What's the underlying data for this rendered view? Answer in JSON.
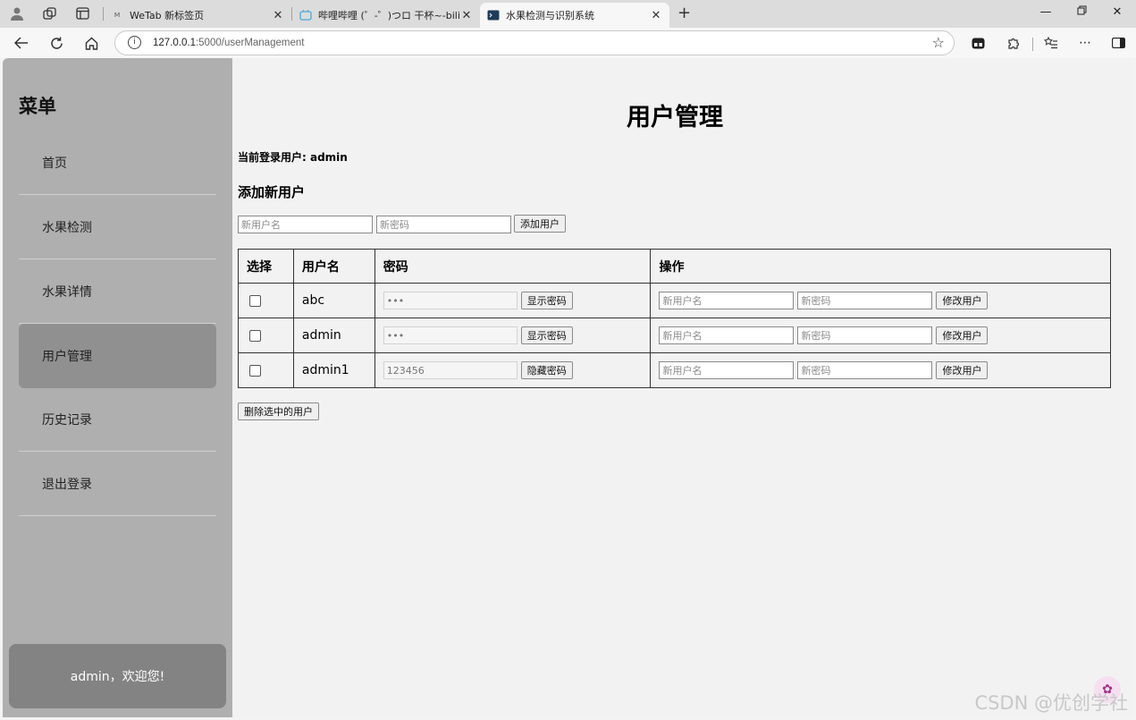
{
  "browser": {
    "tabs": [
      {
        "title": "WeTab 新标签页",
        "active": false
      },
      {
        "title": "哔哩哔哩 (゜-゜)つロ 干杯~-bilibili",
        "active": false
      },
      {
        "title": "水果检测与识别系统",
        "active": true
      }
    ],
    "url_host": "127.0.0.1",
    "url_path": ":5000/userManagement"
  },
  "sidebar": {
    "title": "菜单",
    "items": [
      {
        "label": "首页"
      },
      {
        "label": "水果检测"
      },
      {
        "label": "水果详情"
      },
      {
        "label": "用户管理"
      },
      {
        "label": "历史记录"
      },
      {
        "label": "退出登录"
      }
    ],
    "welcome": "admin，欢迎您!"
  },
  "main": {
    "title": "用户管理",
    "current_user": "当前登录用户: admin",
    "add_heading": "添加新用户",
    "add_form": {
      "username_placeholder": "新用户名",
      "password_placeholder": "新密码",
      "add_button": "添加用户"
    },
    "table": {
      "headers": [
        "选择",
        "用户名",
        "密码",
        "操作"
      ],
      "rows": [
        {
          "username": "abc",
          "password_display": "•••",
          "toggle_label": "显示密码",
          "new_username_placeholder": "新用户名",
          "new_password_placeholder": "新密码",
          "modify_label": "修改用户"
        },
        {
          "username": "admin",
          "password_display": "•••",
          "toggle_label": "显示密码",
          "new_username_placeholder": "新用户名",
          "new_password_placeholder": "新密码",
          "modify_label": "修改用户"
        },
        {
          "username": "admin1",
          "password_display": "123456",
          "toggle_label": "隐藏密码",
          "new_username_placeholder": "新用户名",
          "new_password_placeholder": "新密码",
          "modify_label": "修改用户"
        }
      ]
    },
    "delete_button": "删除选中的用户"
  },
  "watermark": "CSDN @优创学社"
}
